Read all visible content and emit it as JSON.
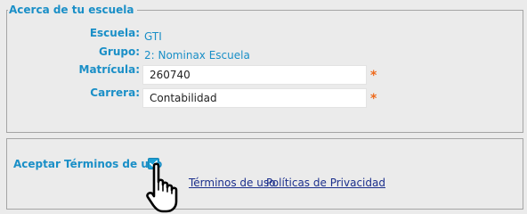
{
  "school_section": {
    "legend": "Acerca de tu escuela",
    "escuela_label": "Escuela:",
    "escuela_value": "GTI",
    "grupo_label": "Grupo:",
    "grupo_value": "2: Nominax Escuela",
    "matricula_label": "Matrícula:",
    "matricula_value": "260740",
    "carrera_label": "Carrera:",
    "carrera_value": "Contabilidad",
    "required_mark": "*"
  },
  "terms_section": {
    "accept_label": "Aceptar Términos de uso",
    "accept_checked": true,
    "terms_link": "Términos de uso",
    "privacy_link": "Políticas de Privacidad"
  },
  "colors": {
    "background": "#ebebeb",
    "label_blue": "#1a8fc7",
    "required_orange": "#ee6a1c",
    "link_navy": "#1b2f8c",
    "checkbox_blue": "#1e9fd4"
  },
  "icons": {
    "cursor": "hand-pointer-icon",
    "checkbox": "checkmark-icon"
  }
}
